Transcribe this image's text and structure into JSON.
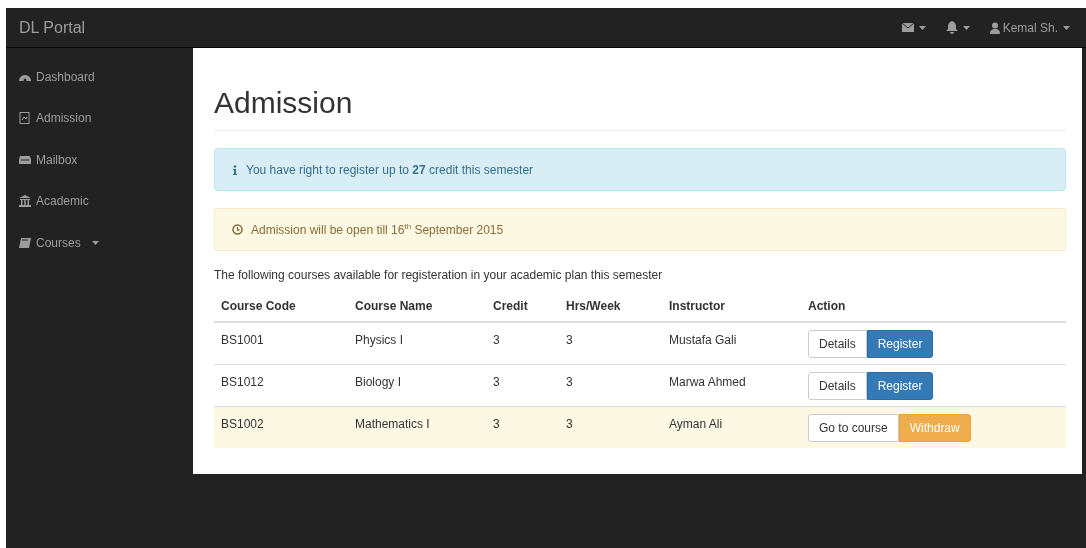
{
  "navbar": {
    "brand": "DL Portal",
    "user": "Kemal Sh."
  },
  "sidebar": {
    "items": [
      {
        "label": "Dashboard",
        "kind": "dashboard",
        "dropdown": false
      },
      {
        "label": "Admission",
        "kind": "file",
        "dropdown": false
      },
      {
        "label": "Mailbox",
        "kind": "inbox",
        "dropdown": false
      },
      {
        "label": "Academic",
        "kind": "bank",
        "dropdown": false
      },
      {
        "label": "Courses",
        "kind": "book",
        "dropdown": true
      }
    ]
  },
  "page": {
    "title": "Admission",
    "alerts": [
      {
        "kind": "info",
        "text": "You have right to register up to **27** credit this semester"
      },
      {
        "kind": "warning",
        "text": "Admission will be open till 16$^{th}$ September 2015"
      }
    ],
    "intro": "The following courses available for registeration in your academic plan this semester"
  },
  "table": {
    "columns": [
      "Course Code",
      "Course Name",
      "Credit",
      "Hrs/Week",
      "Instructor",
      "Action"
    ],
    "rows": [
      {
        "cells": [
          "BS1001",
          "Physics I",
          "3",
          "3",
          "Mustafa Gali"
        ],
        "highlighted": false,
        "actions": [
          {
            "label": "Details",
            "kind": "default"
          },
          {
            "label": "Register",
            "kind": "primary"
          }
        ]
      },
      {
        "cells": [
          "BS1012",
          "Biology I",
          "3",
          "3",
          "Marwa Ahmed"
        ],
        "highlighted": false,
        "actions": [
          {
            "label": "Details",
            "kind": "default"
          },
          {
            "label": "Register",
            "kind": "primary"
          }
        ]
      },
      {
        "cells": [
          "BS1002",
          "Mathematics I",
          "3",
          "3",
          "Ayman Ali"
        ],
        "highlighted": true,
        "actions": [
          {
            "label": "Go to course",
            "kind": "default"
          },
          {
            "label": "Withdraw",
            "kind": "warning"
          }
        ]
      }
    ]
  }
}
